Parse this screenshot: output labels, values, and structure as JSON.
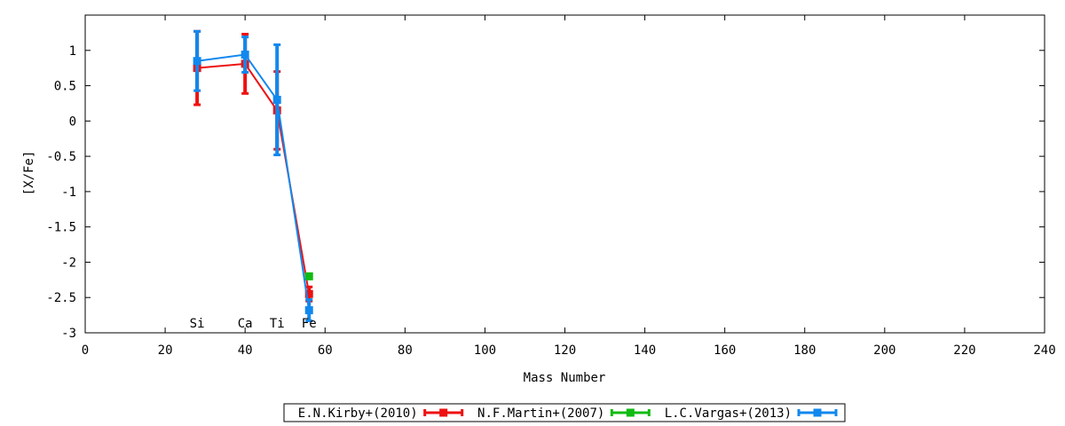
{
  "chart_data": {
    "type": "line",
    "xlabel": "Mass Number",
    "ylabel": "[X/Fe]",
    "xlim": [
      0,
      240
    ],
    "ylim": [
      -3,
      1.5
    ],
    "xticks": [
      0,
      20,
      40,
      60,
      80,
      100,
      120,
      140,
      160,
      180,
      200,
      220,
      240
    ],
    "yticks": [
      1,
      0.5,
      0,
      -0.5,
      -1,
      -1.5,
      -2,
      -2.5,
      -3
    ],
    "grid": false,
    "legend_position": "bottom-center",
    "element_labels": [
      {
        "text": "Si",
        "x": 28
      },
      {
        "text": "Ca",
        "x": 40
      },
      {
        "text": "Ti",
        "x": 48
      },
      {
        "text": "Fe",
        "x": 56
      }
    ],
    "series": [
      {
        "name": "E.N.Kirby+(2010)",
        "color": "#ee1111",
        "x": [
          28,
          40,
          48,
          56
        ],
        "y": [
          0.75,
          0.81,
          0.15,
          -2.45
        ],
        "err": [
          0.52,
          0.42,
          0.55,
          0.1
        ]
      },
      {
        "name": "N.F.Martin+(2007)",
        "color": "#11bb11",
        "x": [
          56
        ],
        "y": [
          -2.2
        ],
        "err": [
          0.03
        ]
      },
      {
        "name": "L.C.Vargas+(2013)",
        "color": "#1188ee",
        "x": [
          28,
          40,
          48,
          56
        ],
        "y": [
          0.85,
          0.94,
          0.3,
          -2.68
        ],
        "err": [
          0.42,
          0.25,
          0.78,
          0.15
        ]
      }
    ]
  }
}
